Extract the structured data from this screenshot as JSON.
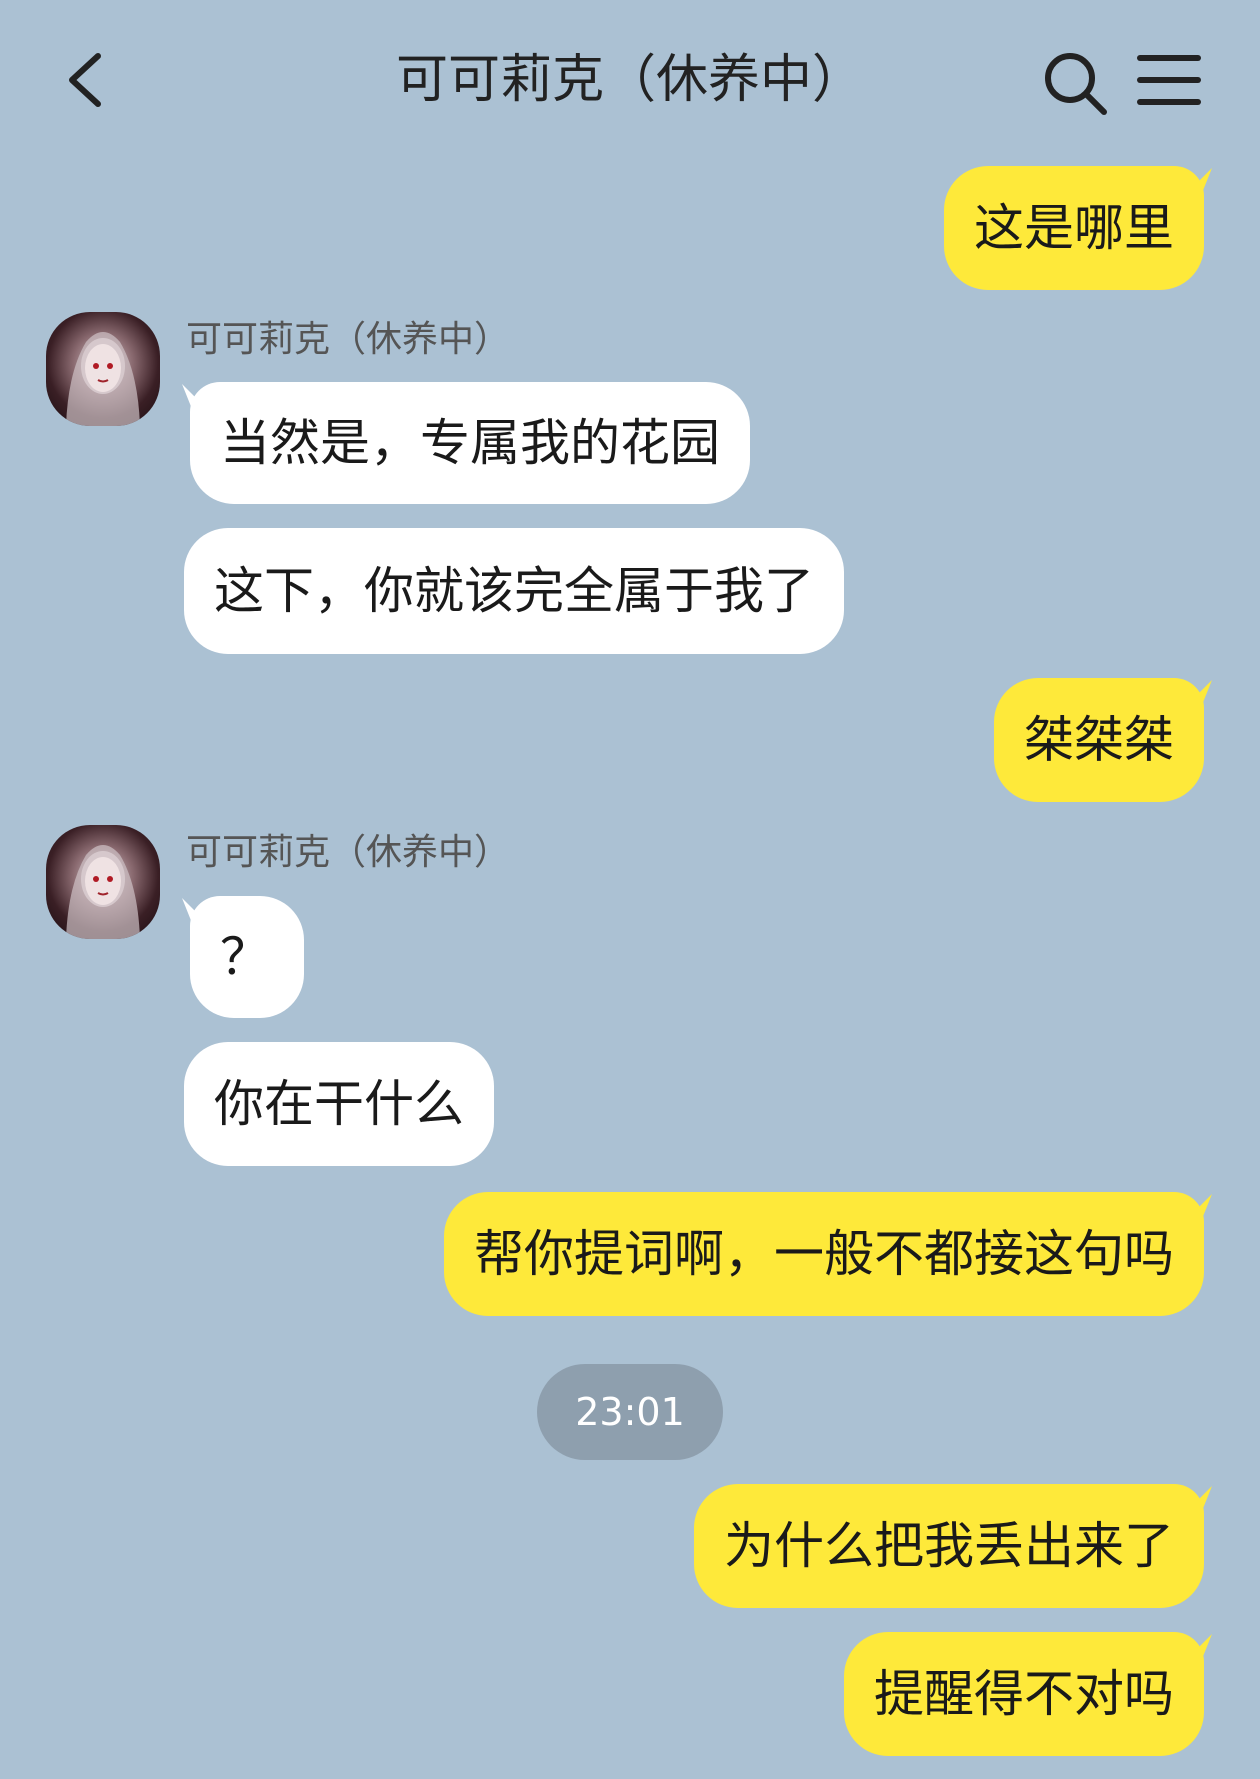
{
  "header": {
    "title": "可可莉克（休养中）",
    "back_icon": "chevron-left-icon",
    "search_icon": "search-icon",
    "menu_icon": "menu-icon"
  },
  "colors": {
    "background": "#abc1d3",
    "outgoing_bubble": "#fee93a",
    "incoming_bubble": "#ffffff",
    "time_pill": "#8e9fae"
  },
  "messages": {
    "m1": "这是哪里",
    "sender1": "可可莉克（休养中）",
    "m2": "当然是，专属我的花园",
    "m3": "这下，你就该完全属于我了",
    "m4": "桀桀桀",
    "sender2": "可可莉克（休养中）",
    "m5": "？",
    "m6": "你在干什么",
    "m7": "帮你提词啊，一般不都接这句吗",
    "time": "23:01",
    "m8": "为什么把我丢出来了",
    "m9": "提醒得不对吗"
  }
}
